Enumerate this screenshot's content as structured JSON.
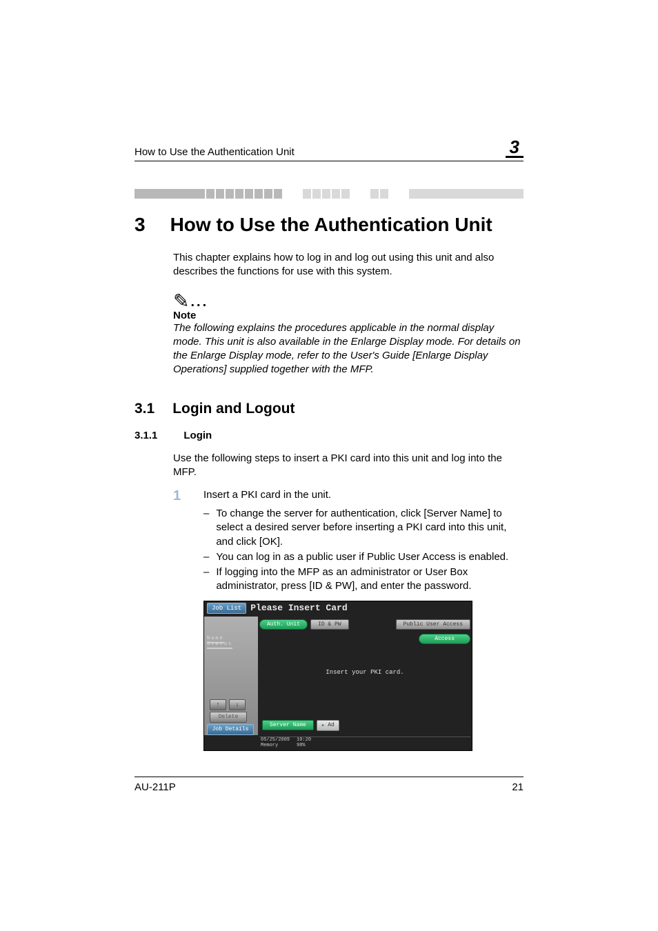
{
  "header": {
    "running_title": "How to Use the Authentication Unit",
    "chapnum": "3"
  },
  "chapter": {
    "num": "3",
    "title": "How to Use the Authentication Unit"
  },
  "intro": "This chapter explains how to log in and log out using this unit and also describes the functions for use with this system.",
  "note": {
    "label": "Note",
    "text": "The following explains the procedures applicable in the normal display mode. This unit is also available in the Enlarge Display mode. For details on the Enlarge Display mode, refer to the User's Guide [Enlarge Display Operations] supplied together with the MFP."
  },
  "section": {
    "num": "3.1",
    "title": "Login and Logout"
  },
  "subsection": {
    "num": "3.1.1",
    "title": "Login"
  },
  "login_intro": "Use the following steps to insert a PKI card into this unit and log into the MFP.",
  "steps": [
    {
      "num": "1",
      "text": "Insert a PKI card in the unit.",
      "sub": [
        "To change the server for authentication, click [Server Name] to select a desired server before inserting a PKI card into this unit, and click [OK].",
        "You can log in as a public user if Public User Access is enabled.",
        "If logging into the MFP as an administrator or User Box administrator, press [ID & PW], and enter the password."
      ]
    }
  ],
  "screen": {
    "joblist": "Job List",
    "title": "Please Insert Card",
    "auth_unit": "Auth. Unit",
    "id_pw": "ID & PW",
    "public": "Public User Access",
    "access": "Access",
    "tabs": {
      "name": "Name",
      "status": "Status"
    },
    "message": "Insert your PKI card.",
    "server_name": "Server Name",
    "server_value": "Ad",
    "delete": "Delete",
    "job_details": "Job Details",
    "date": "05/25/2009",
    "time": "10:20",
    "memory_label": "Memory",
    "memory_value": "98%"
  },
  "footer": {
    "left": "AU-211P",
    "right": "21"
  }
}
